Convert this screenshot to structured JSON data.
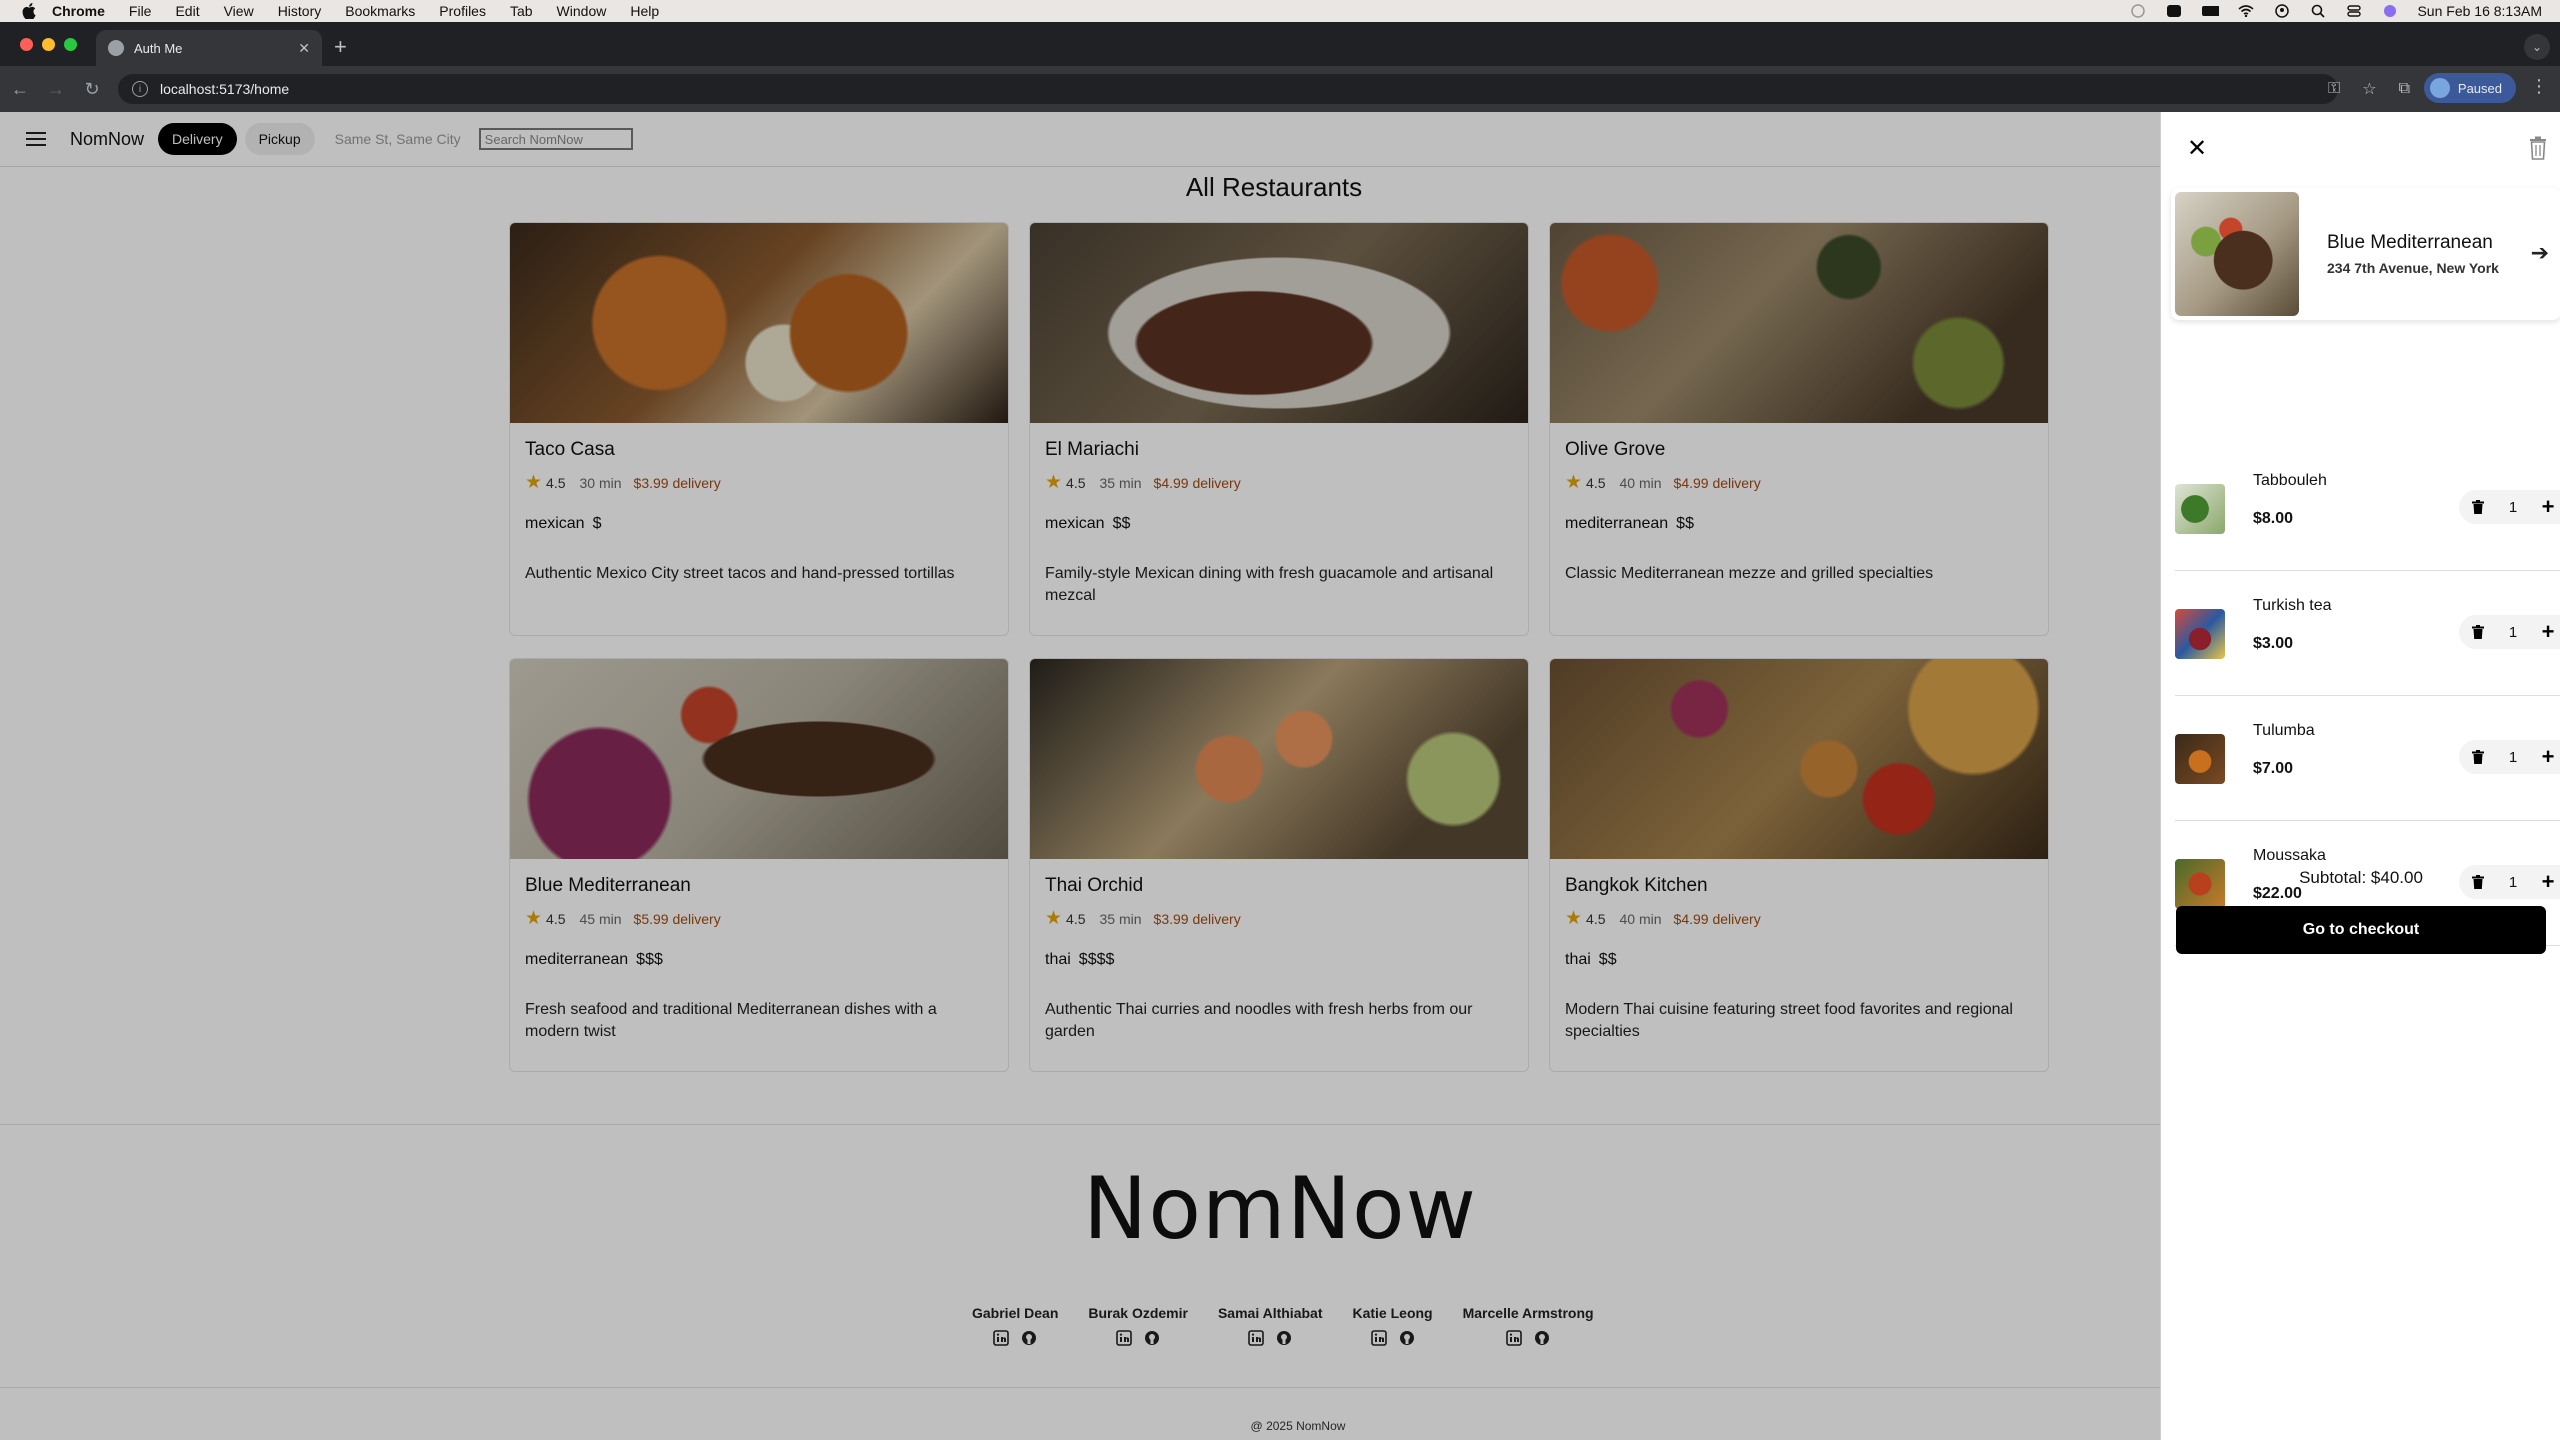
{
  "os_menubar": {
    "apple_icon": "apple-icon",
    "items": [
      "Chrome",
      "File",
      "Edit",
      "View",
      "History",
      "Bookmarks",
      "Profiles",
      "Tab",
      "Window",
      "Help"
    ],
    "clock": "Sun Feb 16  8:13AM"
  },
  "browser": {
    "tab_title": "Auth Me",
    "url": "localhost:5173/home",
    "profile_label": "Paused"
  },
  "header": {
    "brand": "NomNow",
    "delivery_label": "Delivery",
    "pickup_label": "Pickup",
    "address": "Same St, Same City",
    "search_placeholder": "Search NomNow"
  },
  "main": {
    "title": "All Restaurants",
    "restaurants": [
      {
        "name": "Taco Casa",
        "rating": "4.5",
        "time": "30 min",
        "fee": "$3.99 delivery",
        "cuisine": "mexican",
        "price": "$",
        "description": "Authentic Mexico City street tacos and hand-pressed tortillas"
      },
      {
        "name": "El Mariachi",
        "rating": "4.5",
        "time": "35 min",
        "fee": "$4.99 delivery",
        "cuisine": "mexican",
        "price": "$$",
        "description": "Family-style Mexican dining with fresh guacamole and artisanal mezcal"
      },
      {
        "name": "Olive Grove",
        "rating": "4.5",
        "time": "40 min",
        "fee": "$4.99 delivery",
        "cuisine": "mediterranean",
        "price": "$$",
        "description": "Classic Mediterranean mezze and grilled specialties"
      },
      {
        "name": "Blue Mediterranean",
        "rating": "4.5",
        "time": "45 min",
        "fee": "$5.99 delivery",
        "cuisine": "mediterranean",
        "price": "$$$",
        "description": "Fresh seafood and traditional Mediterranean dishes with a modern twist"
      },
      {
        "name": "Thai Orchid",
        "rating": "4.5",
        "time": "35 min",
        "fee": "$3.99 delivery",
        "cuisine": "thai",
        "price": "$$$$",
        "description": "Authentic Thai curries and noodles with fresh herbs from our garden"
      },
      {
        "name": "Bangkok Kitchen",
        "rating": "4.5",
        "time": "40 min",
        "fee": "$4.99 delivery",
        "cuisine": "thai",
        "price": "$$",
        "description": "Modern Thai cuisine featuring street food favorites and regional specialties"
      }
    ]
  },
  "footer": {
    "logo": "NomNow",
    "team": [
      "Gabriel Dean",
      "Burak Ozdemir",
      "Samai Althiabat",
      "Katie Leong",
      "Marcelle Armstrong"
    ],
    "copyright": "@ 2025 NomNow"
  },
  "cart": {
    "store_name": "Blue Mediterranean",
    "store_address": "234 7th Avenue, New York",
    "items": [
      {
        "name": "Tabbouleh",
        "price": "$8.00",
        "qty": "1"
      },
      {
        "name": "Turkish tea",
        "price": "$3.00",
        "qty": "1"
      },
      {
        "name": "Tulumba",
        "price": "$7.00",
        "qty": "1"
      },
      {
        "name": "Moussaka",
        "price": "$22.00",
        "qty": "1"
      }
    ],
    "subtotal": "Subtotal: $40.00",
    "checkout_label": "Go to checkout"
  },
  "colors": {
    "accent_delivery_fee": "#a14a13",
    "star": "#e0a40e",
    "primary_button": "#000000"
  }
}
